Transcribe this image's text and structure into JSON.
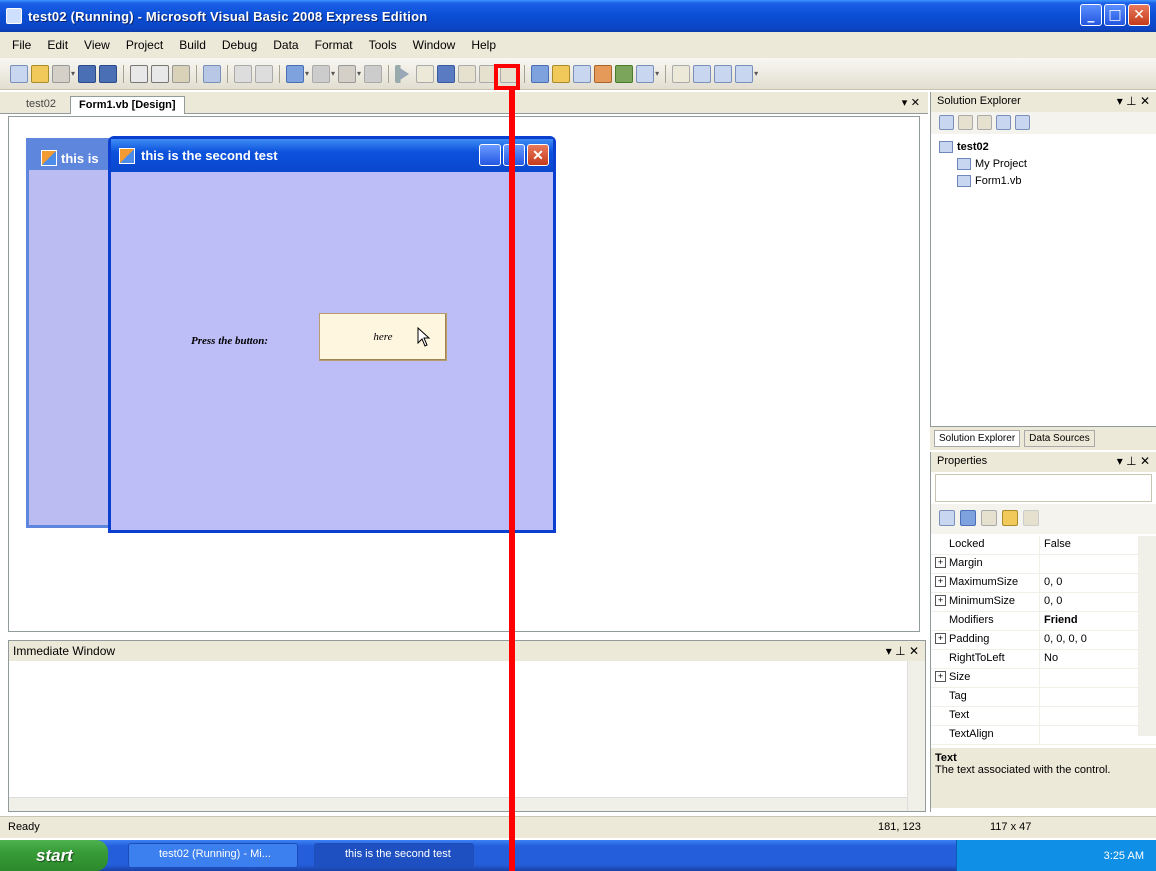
{
  "window": {
    "title": "test02 (Running) - Microsoft Visual Basic 2008 Express Edition",
    "buttons": {
      "minimize": "_",
      "maximize": "□",
      "close": "✕"
    }
  },
  "menu": [
    "File",
    "Edit",
    "View",
    "Project",
    "Build",
    "Debug",
    "Data",
    "Format",
    "Tools",
    "Window",
    "Help"
  ],
  "document_tabs": {
    "inactive": "test02",
    "active": "Form1.vb [Design]",
    "controls": "▾ ✕"
  },
  "designer": {
    "back_form_title": "this is",
    "form_title": "this is the second test",
    "label_text": "Press the button:",
    "button_text": "here"
  },
  "immediate_window": {
    "title": "Immediate Window",
    "controls": "▾ ⊥ ✕"
  },
  "solution_explorer": {
    "title": "Solution Explorer",
    "controls": "▾ ⊥ ✕",
    "project": "test02",
    "items": [
      "My Project",
      "Form1.vb"
    ],
    "tabs": [
      "Solution Explorer",
      "Data Sources"
    ]
  },
  "properties": {
    "title": "Properties",
    "controls": "▾ ⊥ ✕",
    "rows": [
      {
        "name": "Locked",
        "value": "False",
        "expand": false
      },
      {
        "name": "Margin",
        "value": "",
        "expand": true
      },
      {
        "name": "MaximumSize",
        "value": "0, 0",
        "expand": true
      },
      {
        "name": "MinimumSize",
        "value": "0, 0",
        "expand": true
      },
      {
        "name": "Modifiers",
        "value": "Friend",
        "expand": false
      },
      {
        "name": "Padding",
        "value": "0, 0, 0, 0",
        "expand": true
      },
      {
        "name": "RightToLeft",
        "value": "No",
        "expand": false
      },
      {
        "name": "Size",
        "value": "",
        "expand": true
      },
      {
        "name": "Tag",
        "value": "",
        "expand": false
      },
      {
        "name": "Text",
        "value": "",
        "expand": false
      },
      {
        "name": "TextAlign",
        "value": "",
        "expand": false
      }
    ],
    "description_title": "Text",
    "description_text": "The text associated with the control."
  },
  "status_bar": {
    "text": "Ready",
    "position": "181, 123",
    "size": "117 x 47"
  },
  "taskbar": {
    "start": "start",
    "items": [
      "test02 (Running) - Mi...",
      "this is the second test"
    ],
    "clock": "3:25 AM"
  },
  "colors": {
    "annotation": "#ff0000",
    "title_bar": "#0a4ed6",
    "form_background": "#bdbdf7"
  }
}
